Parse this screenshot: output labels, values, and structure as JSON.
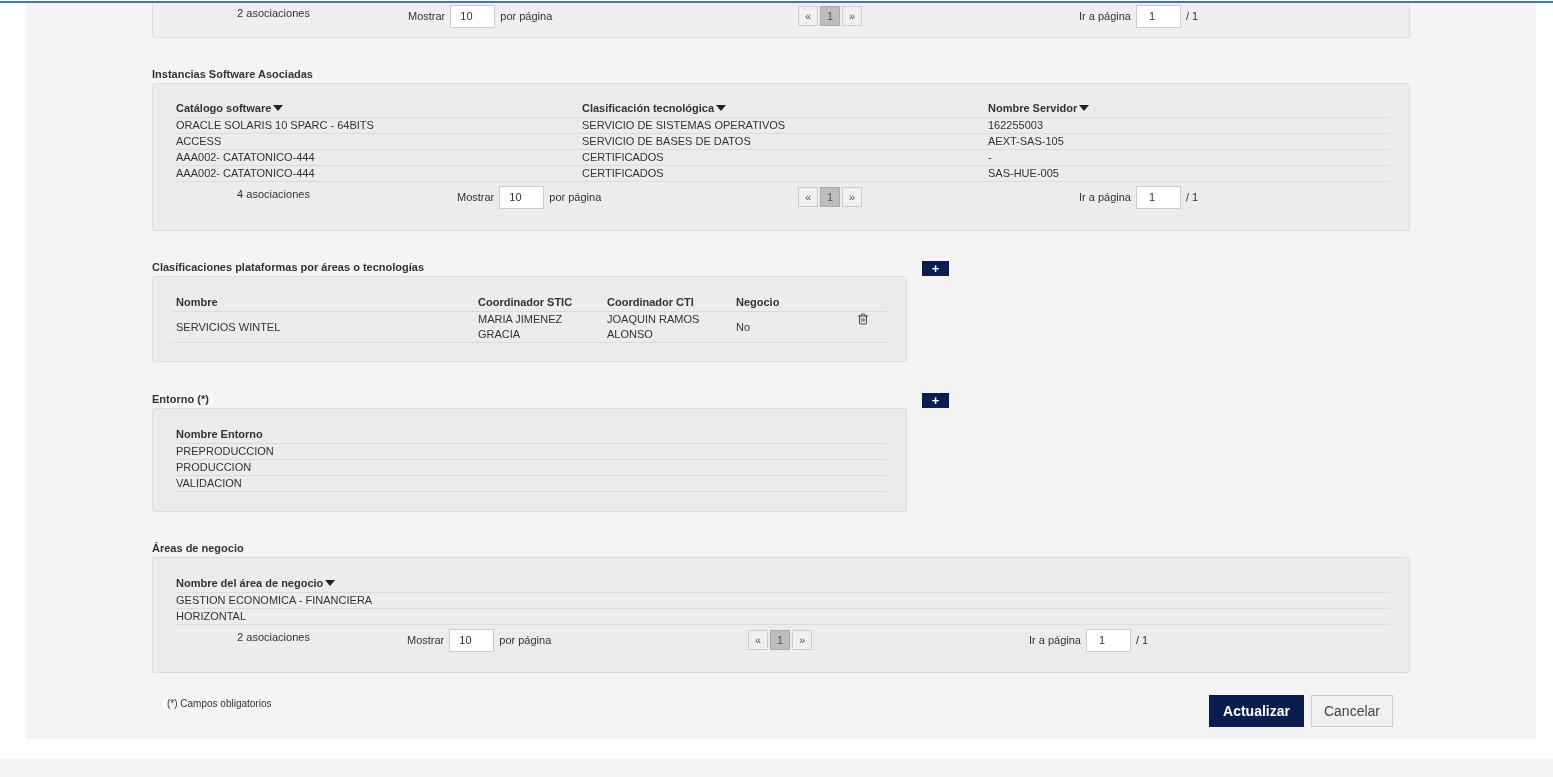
{
  "top_pager": {
    "count": "2 asociaciones",
    "show_label": "Mostrar",
    "page_size": "10",
    "per_page_label": "por página",
    "prev": "«",
    "page": "1",
    "next": "»",
    "goto_label": "Ir a página",
    "goto_value": "1",
    "total": "/ 1"
  },
  "software": {
    "title": "Instancias Software Asociadas",
    "columns": [
      "Catálogo software",
      "Clasificación tecnológica",
      "Nombre Servidor"
    ],
    "rows": [
      [
        "ORACLE SOLARIS 10 SPARC - 64BITS",
        "SERVICIO DE SISTEMAS OPERATIVOS",
        "162255003"
      ],
      [
        "ACCESS",
        "SERVICIO DE BASES DE DATOS",
        "AEXT-SAS-105"
      ],
      [
        "AAA002- CATATONICO-444",
        "CERTIFICADOS",
        "-"
      ],
      [
        "AAA002- CATATONICO-444",
        "CERTIFICADOS",
        "SAS-HUE-005"
      ]
    ],
    "pager": {
      "count": "4 asociaciones",
      "show_label": "Mostrar",
      "page_size": "10",
      "per_page_label": "por página",
      "prev": "«",
      "page": "1",
      "next": "»",
      "goto_label": "Ir a página",
      "goto_value": "1",
      "total": "/ 1"
    }
  },
  "platforms": {
    "title": "Clasificaciones plataformas por áreas o tecnologías",
    "add_label": "+",
    "columns": [
      "Nombre",
      "Coordinador STIC",
      "Coordinador CTI",
      "Negocio"
    ],
    "rows": [
      [
        "SERVICIOS WINTEL",
        "MARIA JIMENEZ GRACIA",
        "JOAQUIN RAMOS ALONSO",
        "No"
      ]
    ]
  },
  "environment": {
    "title": "Entorno (*)",
    "add_label": "+",
    "columns": [
      "Nombre Entorno"
    ],
    "rows": [
      [
        "PREPRODUCCION"
      ],
      [
        "PRODUCCION"
      ],
      [
        "VALIDACION"
      ]
    ]
  },
  "business": {
    "title": "Áreas de negocio",
    "columns": [
      "Nombre del área de negocio"
    ],
    "rows": [
      [
        "GESTION ECONOMICA - FINANCIERA"
      ],
      [
        "HORIZONTAL"
      ]
    ],
    "pager": {
      "count": "2 asociaciones",
      "show_label": "Mostrar",
      "page_size": "10",
      "per_page_label": "por página",
      "prev": "«",
      "page": "1",
      "next": "»",
      "goto_label": "Ir a página",
      "goto_value": "1",
      "total": "/ 1"
    }
  },
  "footnote": "(*) Campos obligatorios",
  "buttons": [
    {
      "label": "Actualizar",
      "kind": "primary"
    },
    {
      "label": "Cancelar",
      "kind": "secondary"
    }
  ]
}
